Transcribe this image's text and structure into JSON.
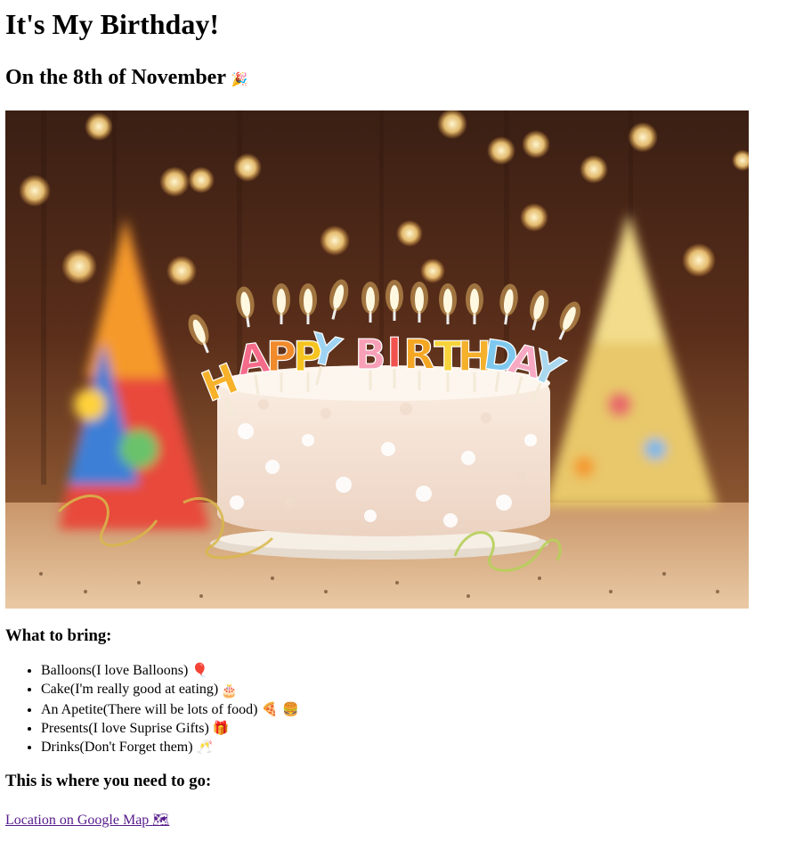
{
  "title": "It's My Birthday!",
  "subtitle": "On the 8th of November",
  "subtitle_emoji": "🎉",
  "image": {
    "cake_text": "HAPPY BIRTHDAY",
    "letters": [
      "H",
      "A",
      "P",
      "P",
      "Y",
      "B",
      "I",
      "R",
      "T",
      "H",
      "D",
      "A",
      "Y"
    ],
    "letter_colors": [
      "#f7b22a",
      "#f56b8a",
      "#f08a2a",
      "#f5c41f",
      "#9fd3f2",
      "#f7a0b7",
      "#f2524e",
      "#f5a623",
      "#f7d43a",
      "#f5b02c",
      "#7ec8ee",
      "#f7a9c3",
      "#a9d8ef"
    ]
  },
  "bring_heading": "What to bring:",
  "bring_items": [
    {
      "text": "Balloons(I love Balloons)",
      "emoji": "🎈"
    },
    {
      "text": "Cake(I'm really good at eating)",
      "emoji": "🎂"
    },
    {
      "text": "An Apetite(There will be lots of food)",
      "emoji": "🍕 🍔"
    },
    {
      "text": "Presents(I love Suprise Gifts)",
      "emoji": "🎁"
    },
    {
      "text": "Drinks(Don't Forget them)",
      "emoji": "🥂"
    }
  ],
  "location_heading": "This is where you need to go:",
  "location_link": {
    "label": "Location on Google Map",
    "emoji": "🗺"
  }
}
